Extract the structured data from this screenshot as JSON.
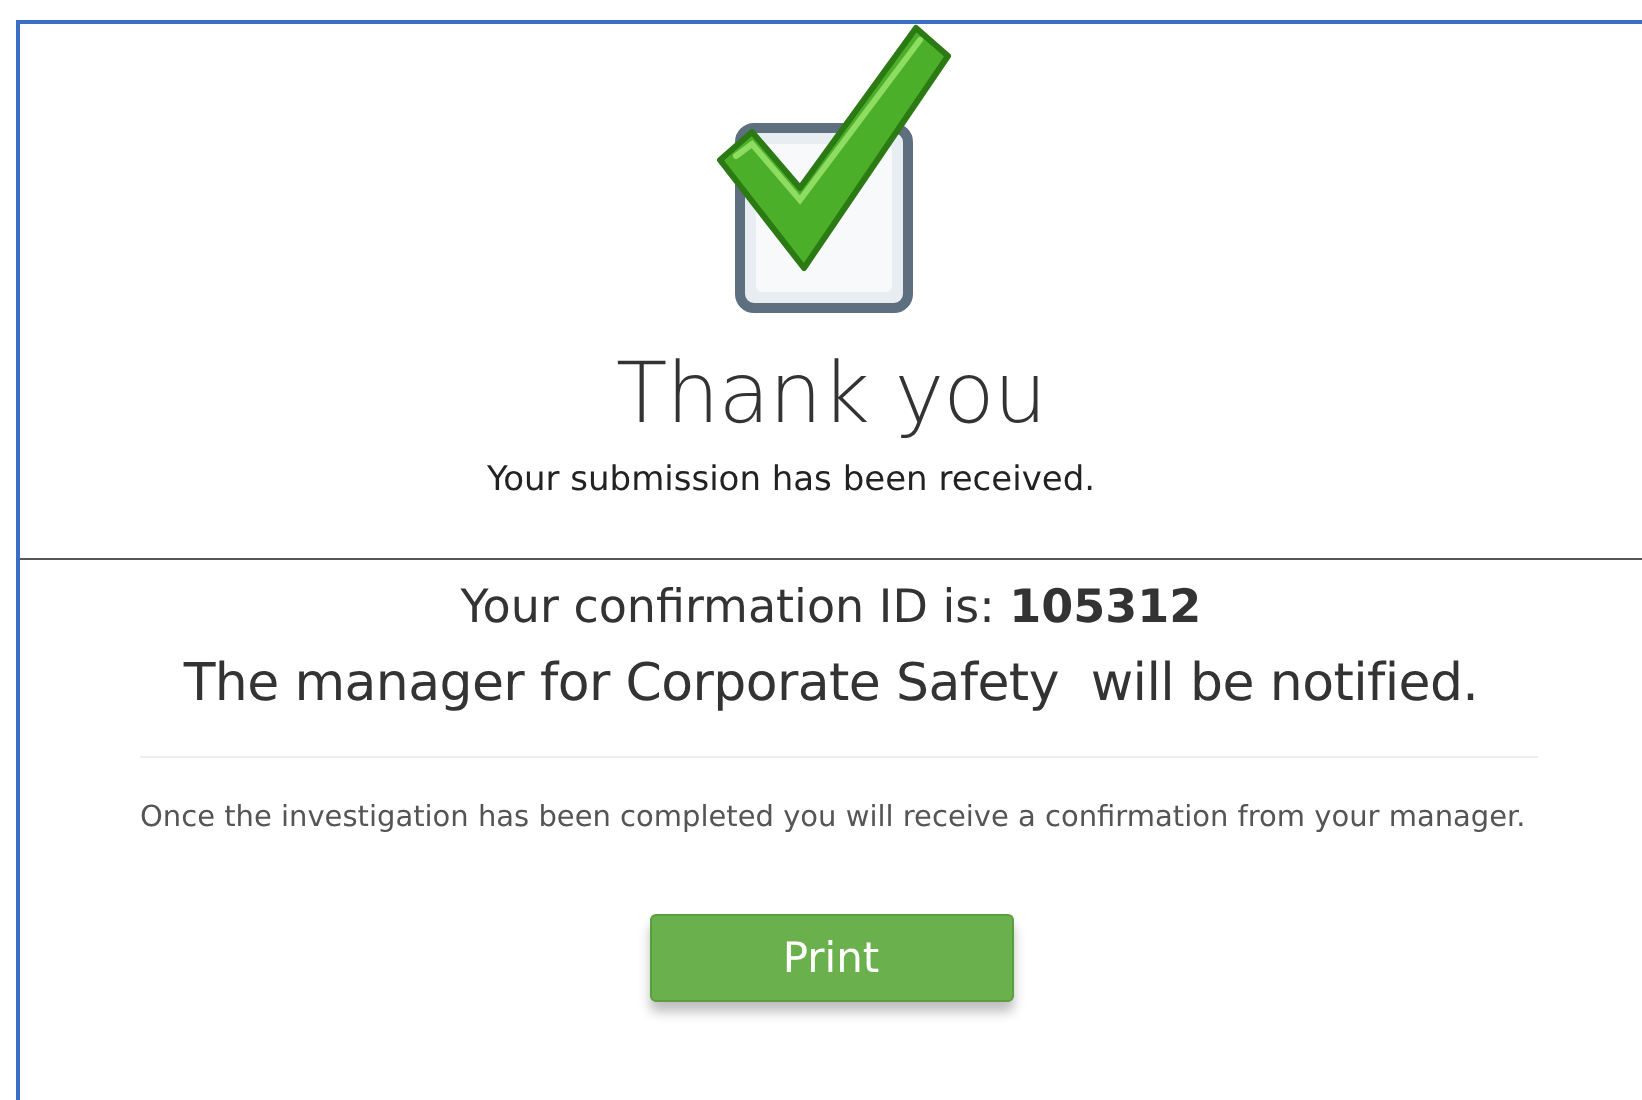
{
  "heading": "Thank you",
  "subtitle": "Your submission has been received.",
  "confirmation": "Your confirmation ID is: **105312**",
  "notice": "The manager for Corporate Safety  will be notified.",
  "message": "Once the investigation has been completed you will receive a confirmation from your manager.",
  "print_button": {
    "label": "Print"
  }
}
